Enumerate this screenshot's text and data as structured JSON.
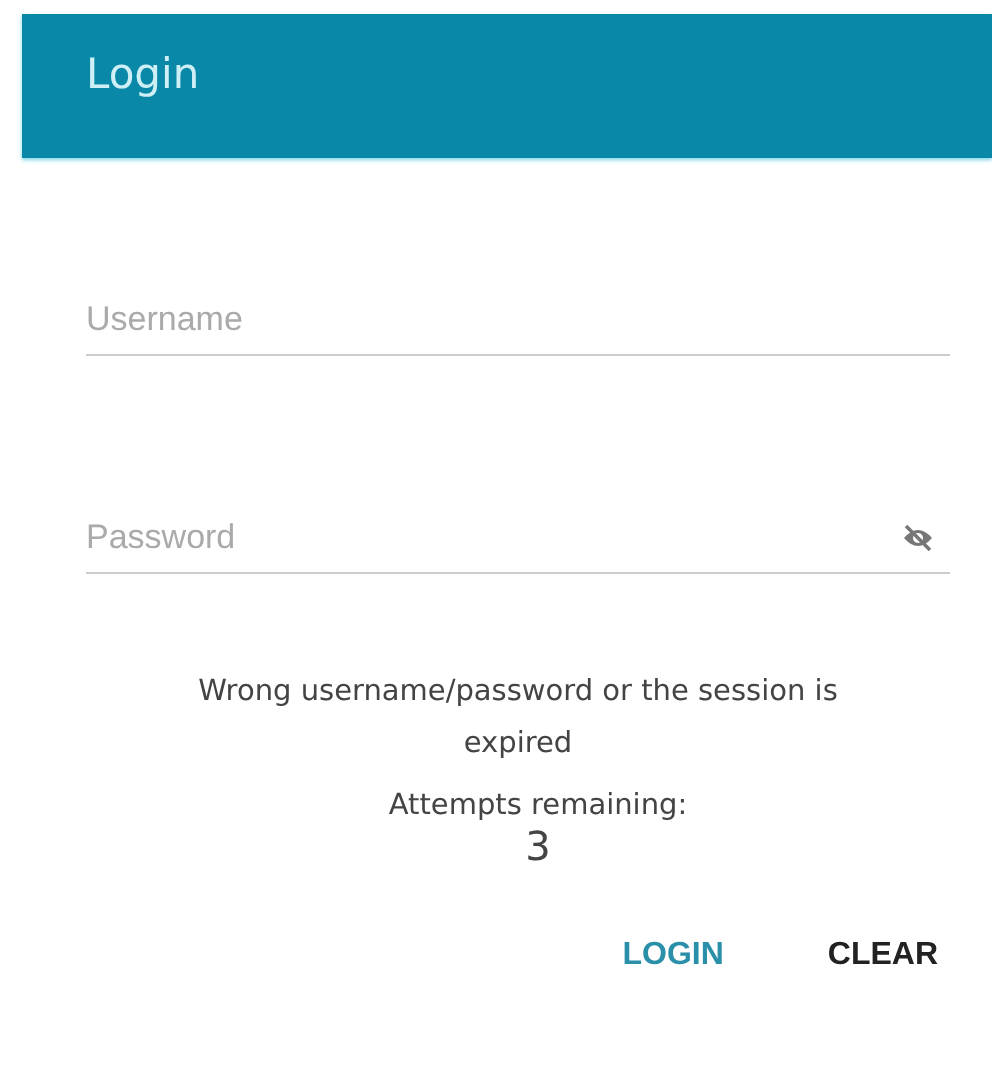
{
  "header": {
    "title": "Login"
  },
  "fields": [
    {
      "kind": "text",
      "placeholder": "Username"
    },
    {
      "kind": "password",
      "placeholder": "Password"
    }
  ],
  "message": "Wrong username/password or the session is expired",
  "attempts": {
    "label": "Attempts remaining:",
    "value": "3"
  },
  "buttons": [
    {
      "kind": "primary",
      "label": "LOGIN"
    },
    {
      "kind": "plain",
      "label": "CLEAR"
    }
  ]
}
